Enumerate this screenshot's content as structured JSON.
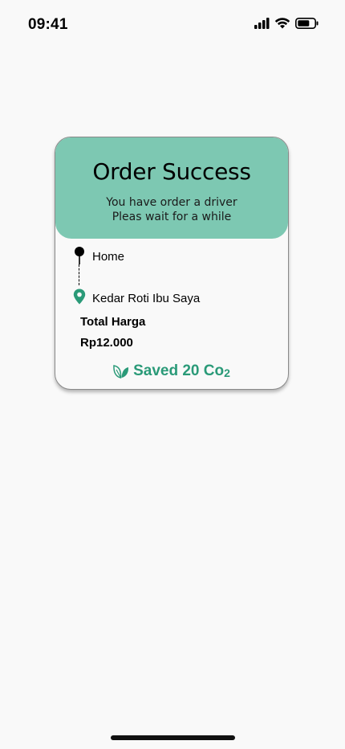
{
  "status_bar": {
    "time": "09:41",
    "icons": [
      "signal-icon",
      "wifi-icon",
      "battery-icon"
    ]
  },
  "card": {
    "title": "Order Success",
    "subtitle_line1": "You have order a driver",
    "subtitle_line2": "Pleas wait for a while",
    "origin": "Home",
    "destination": "Kedar Roti Ibu Saya",
    "total_label": "Total Harga",
    "total_value": "Rp12.000",
    "saved_text": "Saved 20 Co",
    "saved_sub": "2"
  },
  "colors": {
    "header": "#7dc8b2",
    "accent_green": "#2a9a78",
    "background": "#f9f9f9"
  }
}
